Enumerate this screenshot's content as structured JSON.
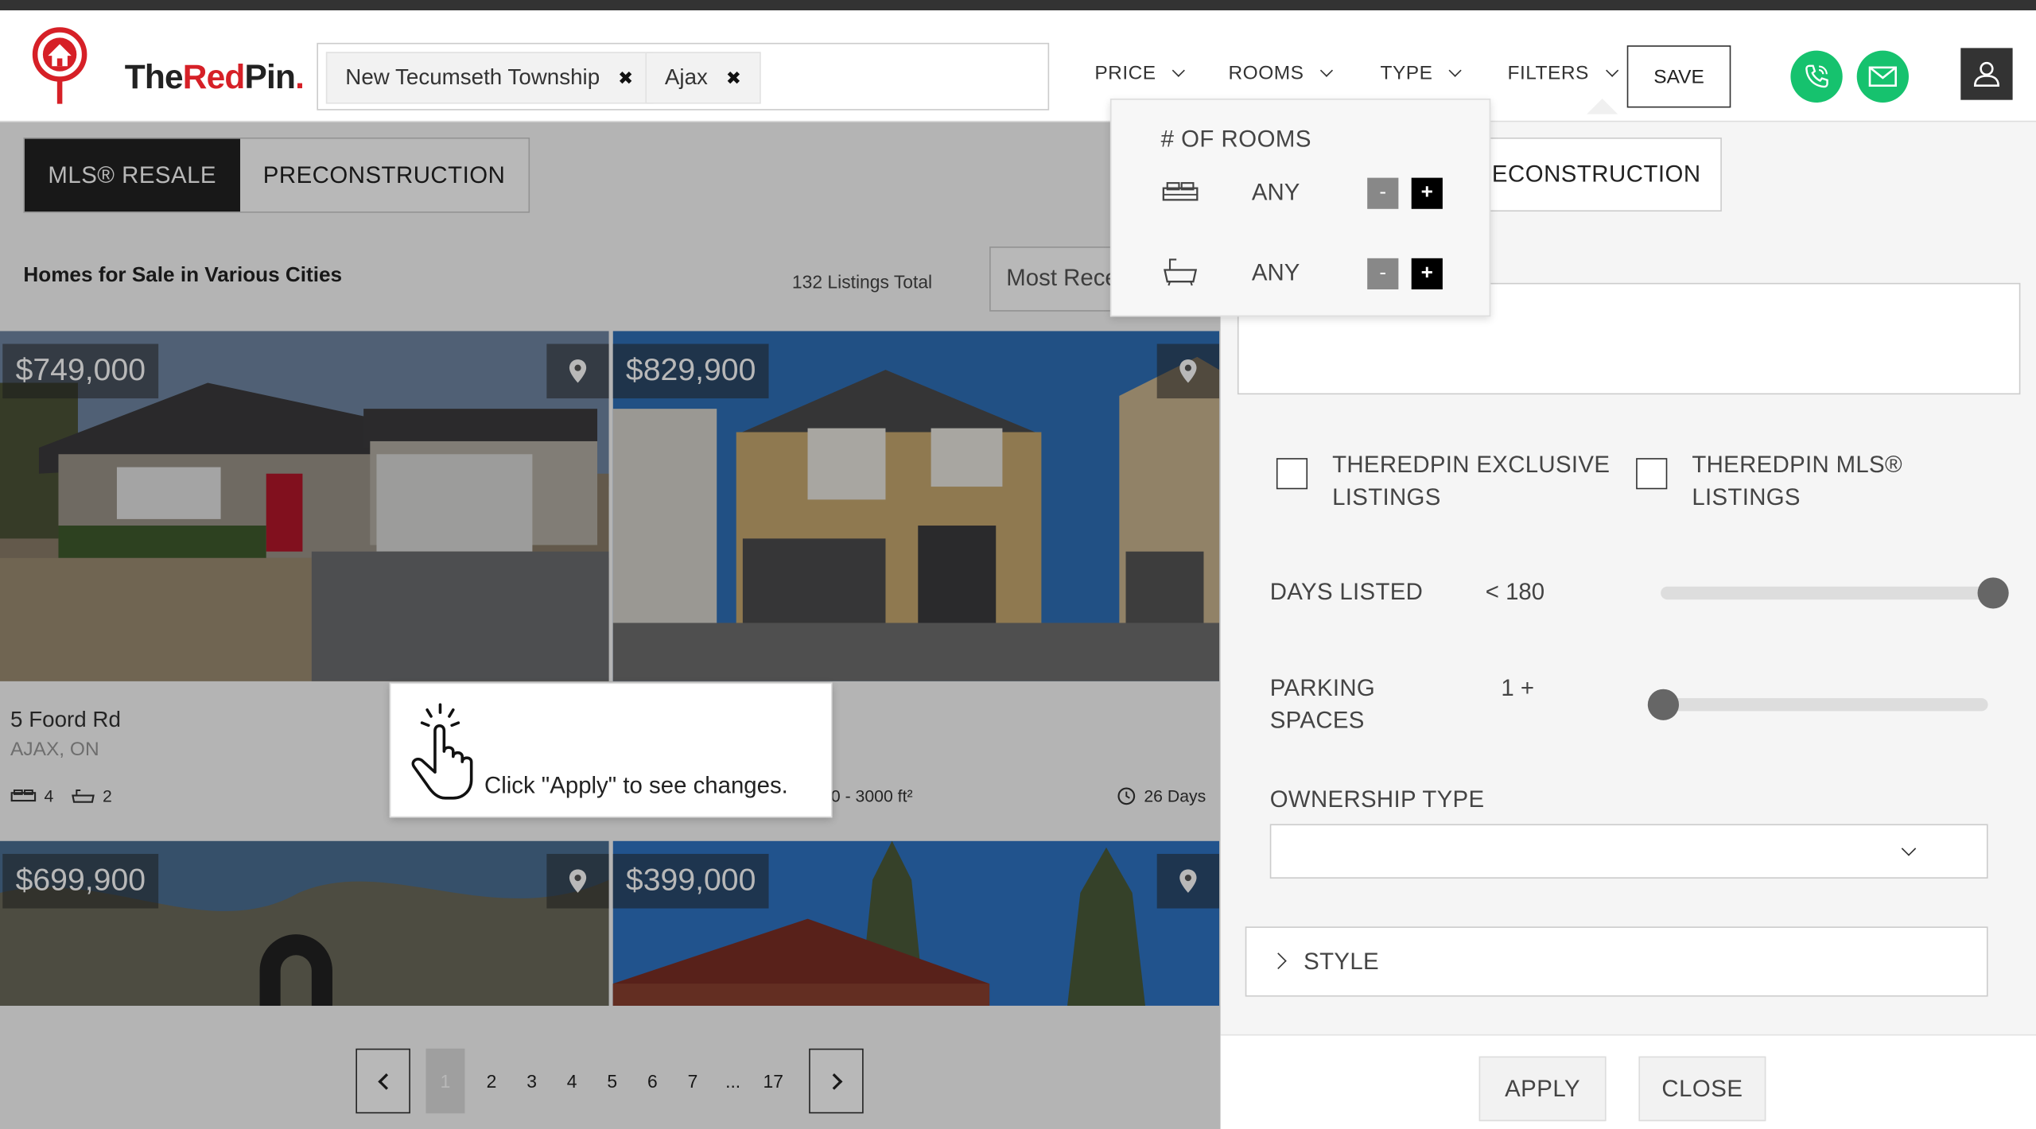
{
  "header": {
    "logo": {
      "part1": "The",
      "part2": "Red",
      "part3": "Pin",
      "dot": "."
    },
    "search_chips": [
      "New Tecumseth Township",
      "Ajax"
    ],
    "chip_remove_glyph": "✖",
    "nav": {
      "price": "PRICE",
      "rooms": "ROOMS",
      "type": "TYPE",
      "filters": "FILTERS"
    },
    "save": "SAVE",
    "icons": [
      "phone-icon",
      "mail-icon",
      "user-icon"
    ]
  },
  "listing_tabs": {
    "mls": "MLS® RESALE",
    "precon": "PRECONSTRUCTION"
  },
  "list_header": {
    "title": "Homes for Sale in Various Cities",
    "total": "132 Listings Total",
    "sort": "Most Recent"
  },
  "listings": [
    {
      "price": "$749,000",
      "address": "5 Foord Rd",
      "city": "AJAX, ON",
      "beds": "4",
      "baths": "2"
    },
    {
      "price": "$829,900",
      "size": "0 - 3000 ft²",
      "days": "26 Days"
    },
    {
      "price": "$699,900"
    },
    {
      "price": "$399,000"
    }
  ],
  "tooltip": {
    "text": "Click \"Apply\" to see changes."
  },
  "pagination": {
    "pages": [
      "1",
      "2",
      "3",
      "4",
      "5",
      "6",
      "7",
      "...",
      "17"
    ],
    "current": "1"
  },
  "rooms_popover": {
    "title": "# OF ROOMS",
    "bedrooms": "ANY",
    "bathrooms": "ANY",
    "minus": "-",
    "plus": "+"
  },
  "filters_panel": {
    "precon_tab": "ECONSTRUCTION",
    "exclusive_line1": "THEREDPIN EXCLUSIVE",
    "exclusive_line2": "LISTINGS",
    "mls_line1": "THEREDPIN MLS®",
    "mls_line2": "LISTINGS",
    "days_listed_label": "DAYS LISTED",
    "days_listed_value": "< 180",
    "days_listed_level": 1.0,
    "parking_line1": "PARKING",
    "parking_line2": "SPACES",
    "parking_value": "1 +",
    "parking_level": 0.0,
    "ownership_label": "OWNERSHIP TYPE",
    "ownership_value": "",
    "style_label": "STYLE",
    "apply": "APPLY",
    "close": "CLOSE"
  },
  "colors": {
    "brand_red": "#d62027",
    "accent_green": "#16c26e",
    "dark": "#222222"
  }
}
